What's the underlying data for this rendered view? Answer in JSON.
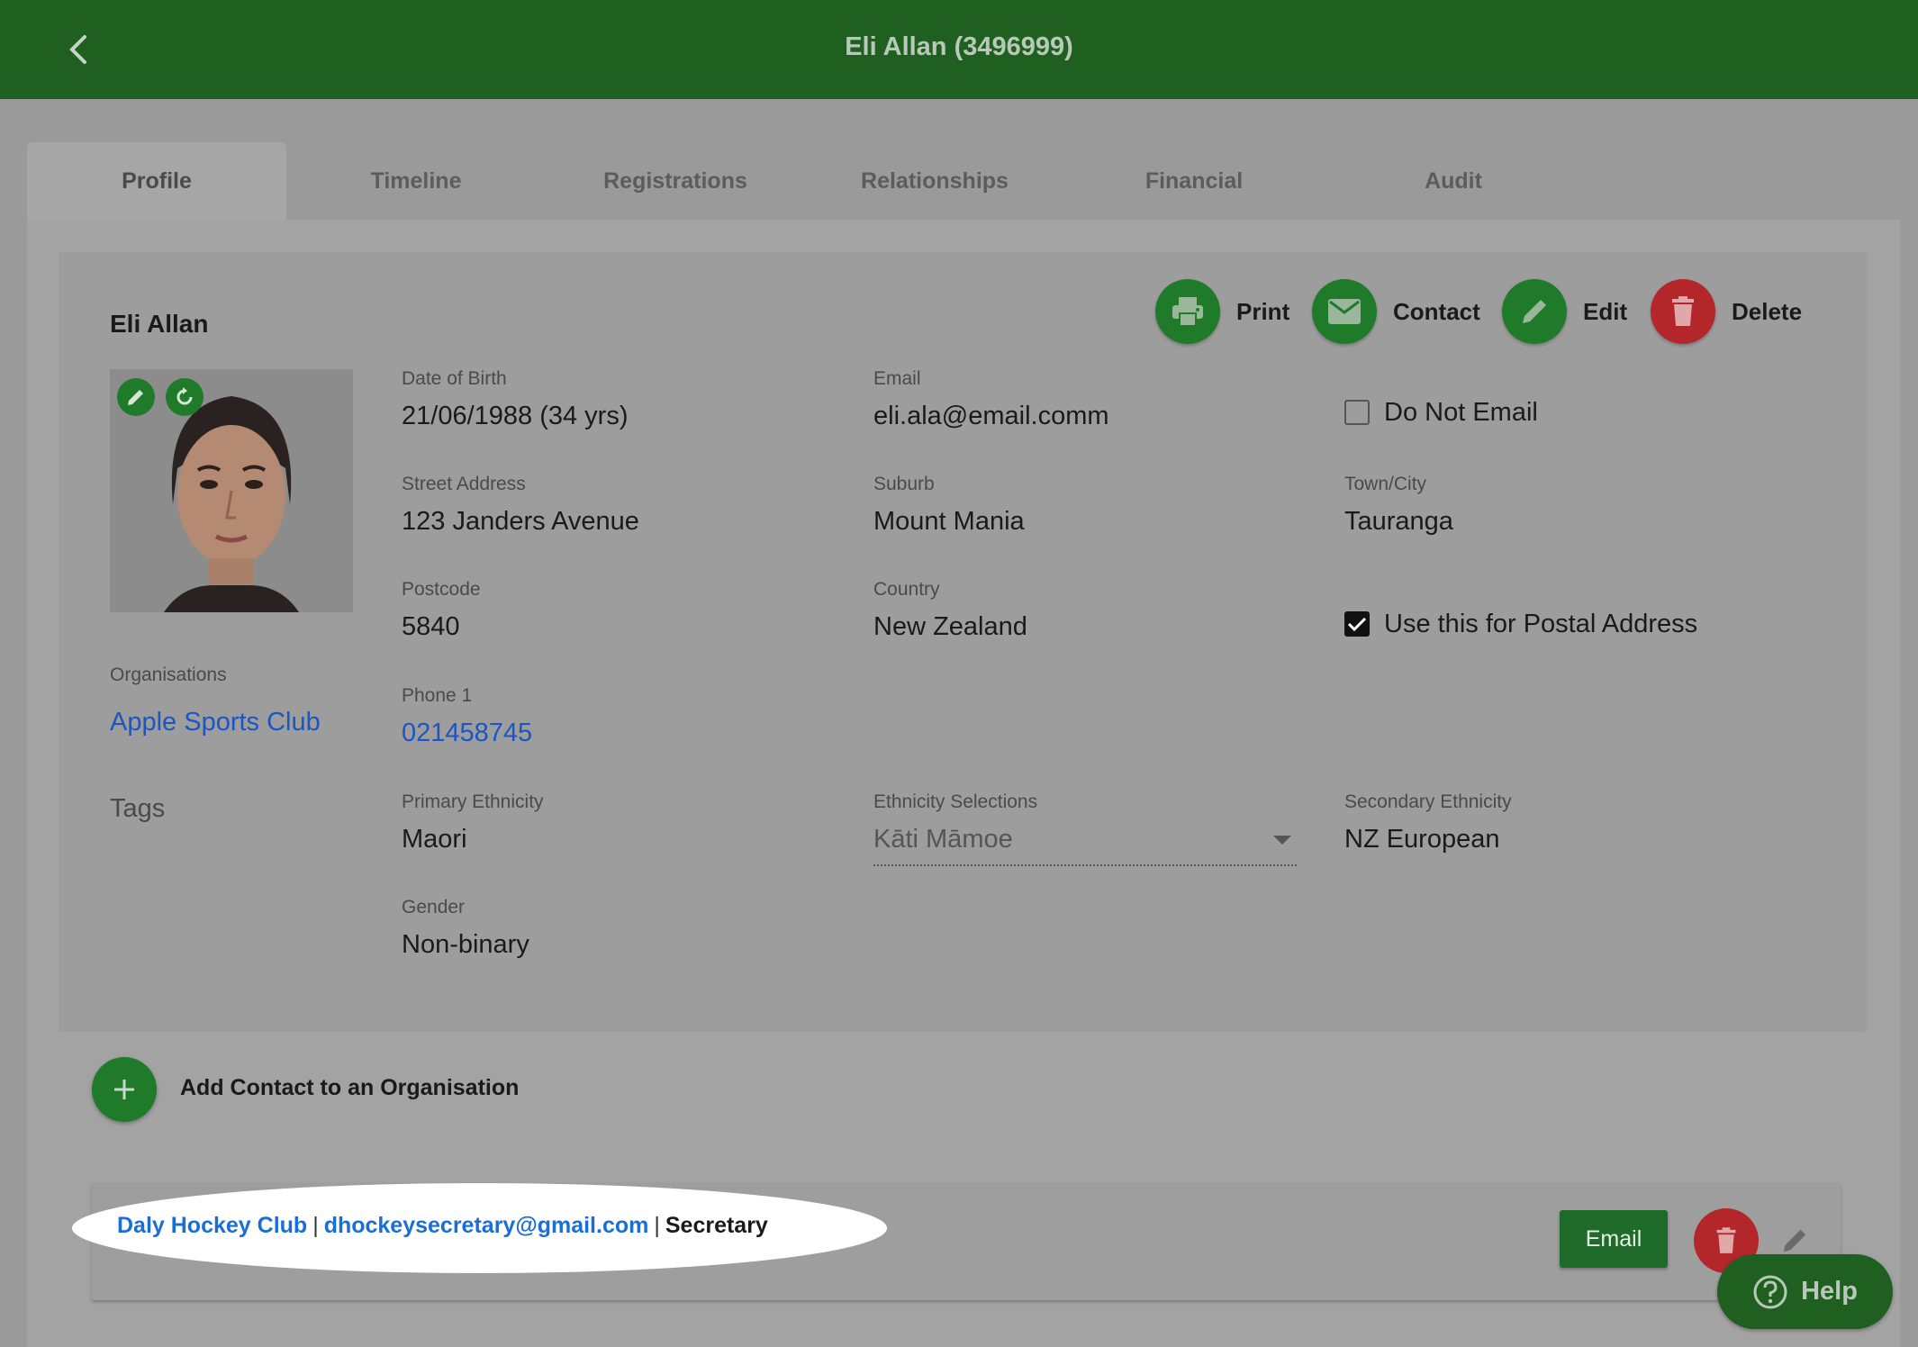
{
  "header": {
    "title": "Eli Allan (3496999)",
    "back_icon": "chevron-left-icon"
  },
  "tabs": [
    {
      "label": "Profile",
      "active": true
    },
    {
      "label": "Timeline"
    },
    {
      "label": "Registrations"
    },
    {
      "label": "Relationships"
    },
    {
      "label": "Financial"
    },
    {
      "label": "Audit"
    }
  ],
  "profile": {
    "name": "Eli Allan",
    "actions": {
      "print": "Print",
      "contact": "Contact",
      "edit": "Edit",
      "delete": "Delete"
    },
    "fields": {
      "dob": {
        "label": "Date of Birth",
        "value": "21/06/1988 (34 yrs)"
      },
      "email": {
        "label": "Email",
        "value": "eli.ala@email.comm"
      },
      "do_not_email": {
        "label": "Do Not Email",
        "checked": false
      },
      "street": {
        "label": "Street Address",
        "value": "123 Janders Avenue"
      },
      "suburb": {
        "label": "Suburb",
        "value": "Mount Mania"
      },
      "town": {
        "label": "Town/City",
        "value": "Tauranga"
      },
      "postcode": {
        "label": "Postcode",
        "value": "5840"
      },
      "country": {
        "label": "Country",
        "value": "New Zealand"
      },
      "postal": {
        "label": "Use this for Postal Address",
        "checked": true
      },
      "phone1": {
        "label": "Phone 1",
        "value": "021458745"
      },
      "primary_ethnicity": {
        "label": "Primary Ethnicity",
        "value": "Maori"
      },
      "ethnicity_selections": {
        "label": "Ethnicity Selections",
        "value": "Kāti Māmoe"
      },
      "secondary_ethnicity": {
        "label": "Secondary Ethnicity",
        "value": "NZ European"
      },
      "gender": {
        "label": "Gender",
        "value": "Non-binary"
      }
    },
    "organisations": {
      "label": "Organisations",
      "value": "Apple Sports Club"
    },
    "tags": {
      "label": "Tags"
    }
  },
  "add_contact": {
    "label": "Add Contact to an Organisation"
  },
  "contact_entry": {
    "club": "Daly Hockey Club",
    "email": "dhockeysecretary@gmail.com",
    "role": "Secretary",
    "separator": "|",
    "email_button": "Email"
  },
  "help": {
    "label": "Help"
  },
  "colors": {
    "header": "#1f5f1f",
    "action_green": "#1f7a2a",
    "action_red": "#b3262a",
    "link": "#1a56c4"
  }
}
